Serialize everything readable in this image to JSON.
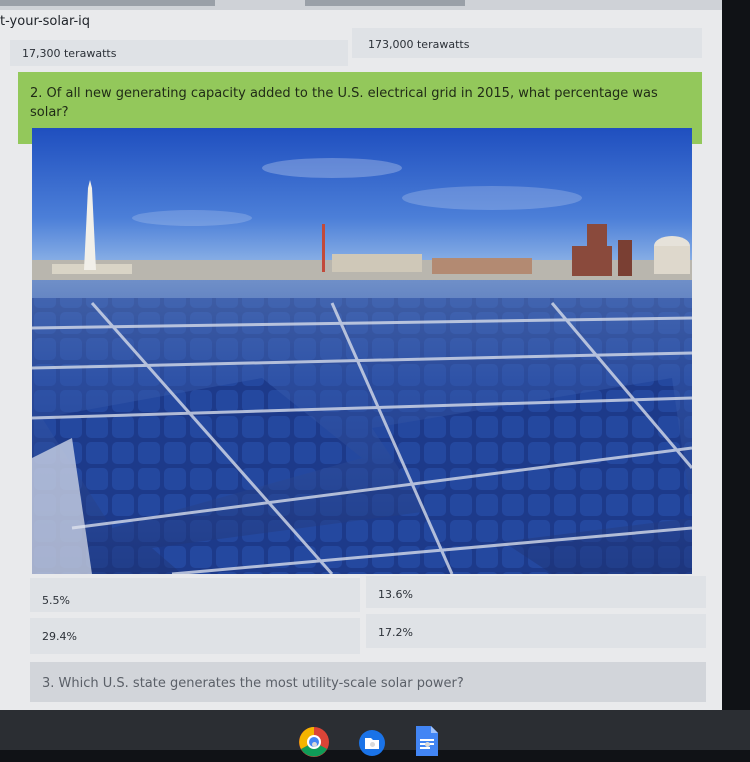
{
  "page": {
    "url_fragment": "t-your-solar-iq"
  },
  "prev_question": {
    "options": [
      "17,300 terawatts",
      "173,000 terawatts"
    ]
  },
  "question2": {
    "text": "2. Of all new generating capacity added to the U.S. electrical grid in 2015, what percentage was solar?",
    "options": [
      "5.5%",
      "13.6%",
      "29.4%",
      "17.2%"
    ]
  },
  "question3": {
    "text": "3. Which U.S. state generates the most utility-scale solar power?"
  },
  "taskbar": {
    "apps": [
      "chrome-icon",
      "files-icon",
      "docs-icon"
    ]
  },
  "colors": {
    "question_header": "#93c85b",
    "option_bg": "#dfe2e6",
    "page_bg": "#e9eaec",
    "taskbar": "#2b2e33"
  }
}
